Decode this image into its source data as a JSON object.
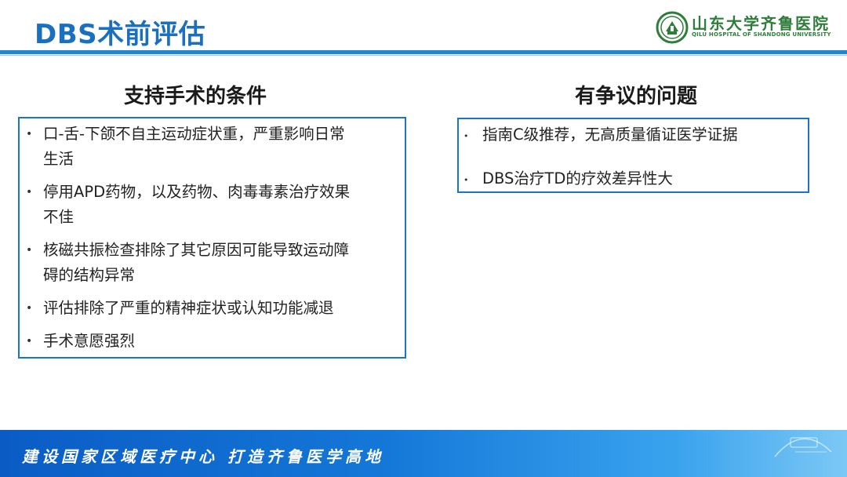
{
  "header": {
    "title": "DBS术前评估",
    "logo_cn": "山东大学齐鲁医院",
    "logo_en": "QILU HOSPITAL OF SHANDONG UNIVERSITY"
  },
  "left": {
    "heading": "支持手术的条件",
    "items": [
      {
        "line1": "口-舌-下颌不自主运动症状重，严重影响日常",
        "line2": "生活"
      },
      {
        "line1": "停用APD药物，以及药物、肉毒毒素治疗效果",
        "line2": "不佳"
      },
      {
        "line1": "核磁共振检查排除了其它原因可能导致运动障",
        "line2": "碍的结构异常"
      },
      {
        "line1": "评估排除了严重的精神症状或认知功能减退",
        "line2": ""
      },
      {
        "line1": "手术意愿强烈",
        "line2": ""
      }
    ]
  },
  "right": {
    "heading": "有争议的问题",
    "items": [
      {
        "text": "指南C级推荐，无高质量循证医学证据"
      },
      {
        "text": "DBS治疗TD的疗效差异性大"
      }
    ]
  },
  "bullet": "•",
  "footer": {
    "slogan": "建设国家区域医疗中心 打造齐鲁医学高地"
  },
  "colors": {
    "title": "#1b6fbf",
    "accent_line": "#1f86d6",
    "box_border": "#1e74c4",
    "logo_green": "#2e7d3a"
  }
}
